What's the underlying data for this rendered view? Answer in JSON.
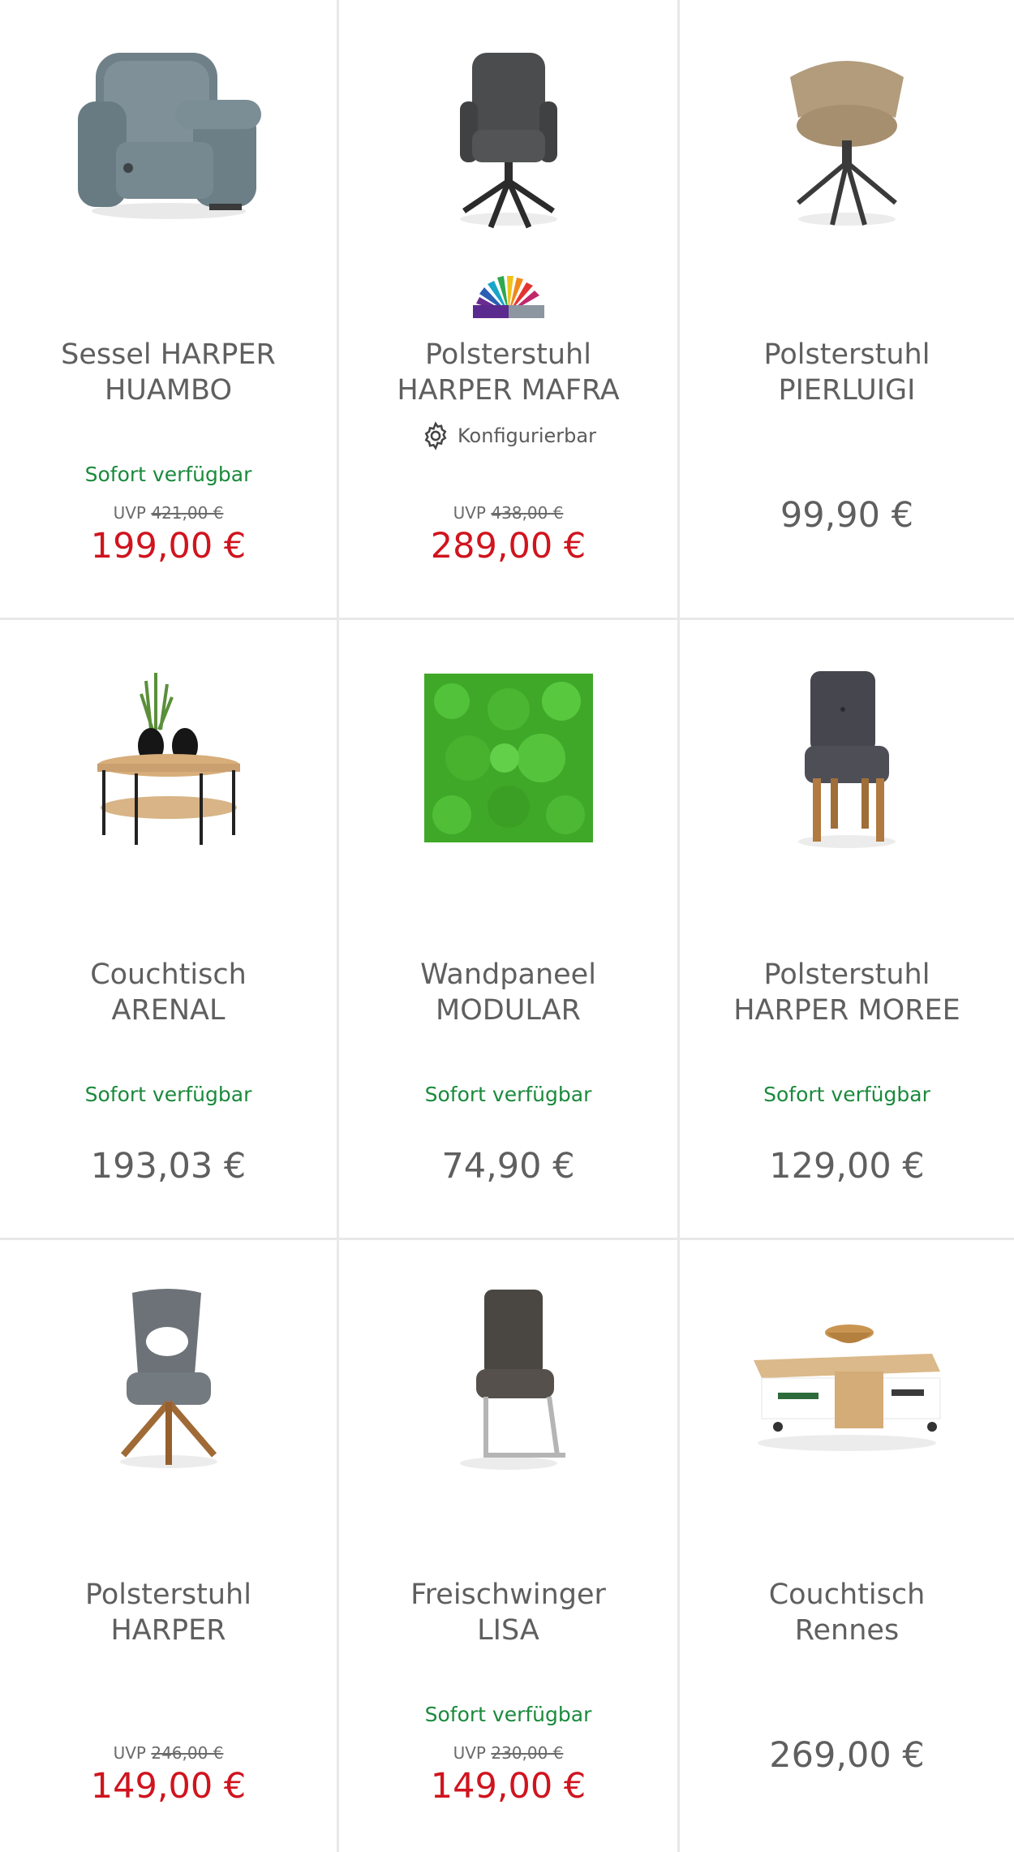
{
  "products": [
    {
      "title_line1": "Sessel HARPER",
      "title_line2": "HUAMBO",
      "availability": "Sofort verfügbar",
      "uvp_label": "UVP",
      "uvp_old": "421,00 €",
      "price": "199,00 €"
    },
    {
      "title_line1": "Polsterstuhl",
      "title_line2": "HARPER MAFRA",
      "configurable": "Konfigurierbar",
      "uvp_label": "UVP",
      "uvp_old": "438,00 €",
      "price": "289,00 €"
    },
    {
      "title_line1": "Polsterstuhl",
      "title_line2": "PIERLUIGI",
      "price": "99,90 €"
    },
    {
      "title_line1": "Couchtisch",
      "title_line2": "ARENAL",
      "availability": "Sofort verfügbar",
      "price": "193,03 €"
    },
    {
      "title_line1": "Wandpaneel",
      "title_line2": "MODULAR",
      "availability": "Sofort verfügbar",
      "price": "74,90 €"
    },
    {
      "title_line1": "Polsterstuhl",
      "title_line2": "HARPER MOREE",
      "availability": "Sofort verfügbar",
      "price": "129,00 €"
    },
    {
      "title_line1": "Polsterstuhl",
      "title_line2": "HARPER",
      "uvp_label": "UVP",
      "uvp_old": "246,00 €",
      "price": "149,00 €"
    },
    {
      "title_line1": "Freischwinger",
      "title_line2": "LISA",
      "availability": "Sofort verfügbar",
      "uvp_label": "UVP",
      "uvp_old": "230,00 €",
      "price": "149,00 €"
    },
    {
      "title_line1": "Couchtisch",
      "title_line2": "Rennes",
      "price": "269,00 €"
    }
  ],
  "icons": {
    "configure": "gear-icon",
    "color_variants": "color-fan-icon"
  },
  "colors": {
    "availability": "#1a8a3c",
    "sale_price": "#d0141e",
    "regular_price": "#5f5f5f"
  }
}
